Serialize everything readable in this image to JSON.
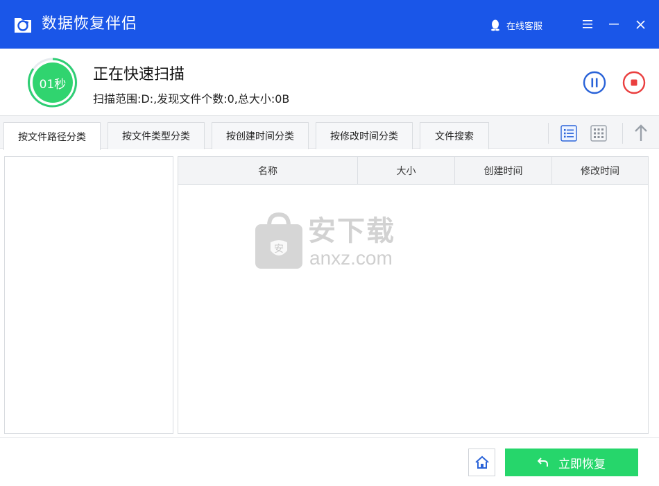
{
  "app": {
    "title": "数据恢复伴侣",
    "support_label": "在线客服",
    "accent_color": "#1a56e8"
  },
  "scan": {
    "timer": "01秒",
    "status": "正在快速扫描",
    "info": "扫描范围:D:,发现文件个数:0,总大小:0B"
  },
  "tabs": [
    {
      "label": "按文件路径分类",
      "active": true
    },
    {
      "label": "按文件类型分类",
      "active": false
    },
    {
      "label": "按创建时间分类",
      "active": false
    },
    {
      "label": "按修改时间分类",
      "active": false
    },
    {
      "label": "文件搜索",
      "active": false
    }
  ],
  "table": {
    "columns": [
      "名称",
      "大小",
      "创建时间",
      "修改时间"
    ]
  },
  "watermark": {
    "cn": "安下载",
    "en": "anxz.com",
    "badge": "安"
  },
  "footer": {
    "recover_label": "立即恢复",
    "recover_color": "#26d66b"
  },
  "icons": {
    "pause": "pause-circle-icon",
    "stop": "stop-circle-icon",
    "list_view": "list-view-icon",
    "grid_view": "grid-view-icon",
    "up": "arrow-up-icon",
    "home": "home-icon"
  }
}
